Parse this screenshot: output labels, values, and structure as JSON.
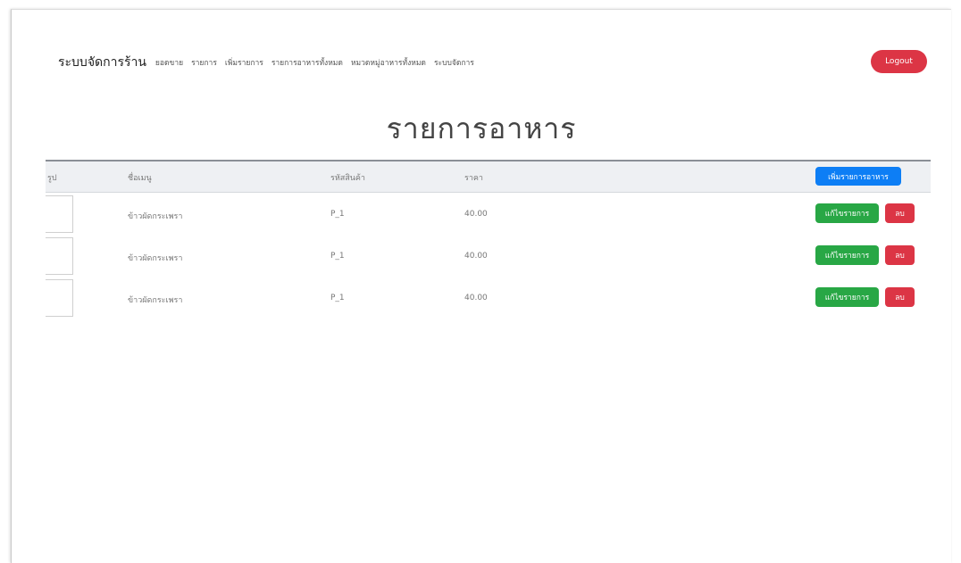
{
  "navbar": {
    "brand": "ระบบจัดการร้าน",
    "links": [
      "ยอดขาย",
      "รายการ",
      "เพิ่มรายการ",
      "รายการอาหารทั้งหมด",
      "หมวดหมู่อาหารทั้งหมด",
      "ระบบจัดการ"
    ],
    "logout": "Logout"
  },
  "page_title": "รายการอาหาร",
  "table": {
    "headers": {
      "image": "รูป",
      "name": "ชื่อเมนู",
      "code": "รหัสสินค้า",
      "price": "ราคา"
    },
    "add_button": "เพิ่มรายการอาหาร",
    "rows": [
      {
        "name": "ข้าวผัดกระเพรา",
        "code": "P_1",
        "price": "40.00"
      },
      {
        "name": "ข้าวผัดกระเพรา",
        "code": "P_1",
        "price": "40.00"
      },
      {
        "name": "ข้าวผัดกระเพรา",
        "code": "P_1",
        "price": "40.00"
      }
    ],
    "edit_label": "แก้ไขรายการ",
    "delete_label": "ลบ"
  },
  "colors": {
    "danger": "#dc3545",
    "primary": "#0d7ef5",
    "success": "#28a745"
  }
}
